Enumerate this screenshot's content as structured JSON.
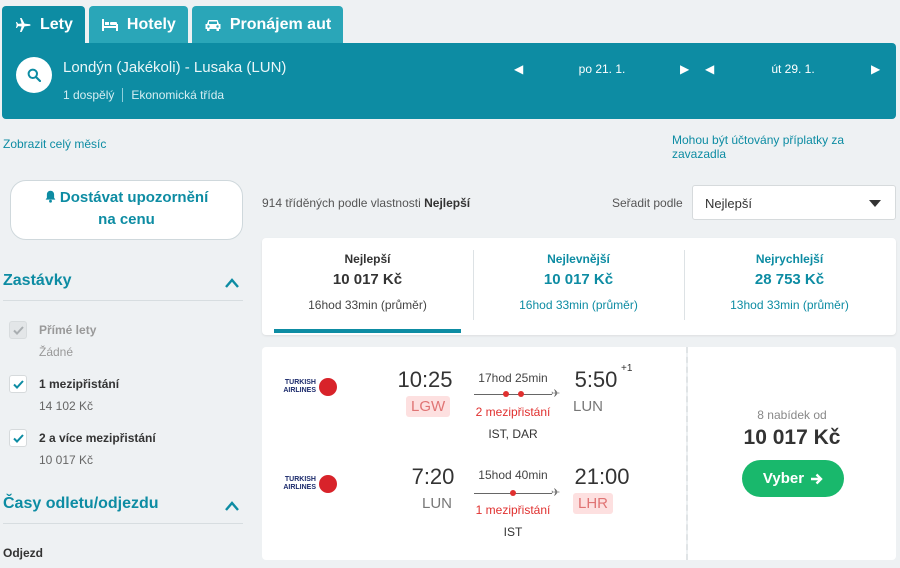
{
  "tabs": [
    {
      "label": "Lety",
      "icon": "plane-icon",
      "active": true
    },
    {
      "label": "Hotely",
      "icon": "bed-icon",
      "active": false
    },
    {
      "label": "Pronájem aut",
      "icon": "car-icon",
      "active": false
    }
  ],
  "search": {
    "route": "Londýn (Jakékoli) - Lusaka (LUN)",
    "passengers": "1 dospělý",
    "cabin": "Ekonomická třída",
    "depart_date": "po 21. 1.",
    "return_date": "út 29. 1."
  },
  "links": {
    "month": "Zobrazit celý měsíc",
    "fees": "Mohou být účtovány příplatky za zavazadla"
  },
  "sidebar": {
    "alert_line1": "Dostávat upozornění",
    "alert_line2": "na cenu",
    "stops_title": "Zastávky",
    "stops": [
      {
        "label": "Přímé lety",
        "price": "Žádné",
        "checked": true,
        "disabled": true
      },
      {
        "label": "1 mezipřistání",
        "price": "14 102 Kč",
        "checked": true,
        "disabled": false
      },
      {
        "label": "2 a více mezipřistání",
        "price": "10 017 Kč",
        "checked": true,
        "disabled": false
      }
    ],
    "times_title": "Časy odletu/odjezdu",
    "departure_label": "Odjezd"
  },
  "results": {
    "count_text": "914 tříděných podle vlastnosti",
    "count_sort": "Nejlepší",
    "sort_label": "Seřadit podle",
    "sort_value": "Nejlepší"
  },
  "sort_cards": [
    {
      "title": "Nejlepší",
      "price": "10 017 Kč",
      "duration": "16hod 33min (průměr)"
    },
    {
      "title": "Nejlevnější",
      "price": "10 017 Kč",
      "duration": "16hod 33min (průměr)"
    },
    {
      "title": "Nejrychlejší",
      "price": "28 753 Kč",
      "duration": "13hod 33min (průměr)"
    }
  ],
  "result": {
    "outbound": {
      "airline": "TURKISH AIRLINES",
      "depart_time": "10:25",
      "arrive_time": "5:50",
      "day_offset": "+1",
      "from": "LGW",
      "to": "LUN",
      "duration": "17hod 25min",
      "stops": "2 mezipřistání",
      "via": "IST, DAR"
    },
    "inbound": {
      "airline": "TURKISH AIRLINES",
      "depart_time": "7:20",
      "arrive_time": "21:00",
      "from": "LUN",
      "to": "LHR",
      "duration": "15hod 40min",
      "stops": "1 mezipřistání",
      "via": "IST"
    },
    "offers": "8 nabídek od",
    "price": "10 017 Kč",
    "select_label": "Vyber"
  },
  "colors": {
    "brand": "#0d8ca3",
    "accent_green": "#19b86c",
    "stop_red": "#e0302f"
  }
}
